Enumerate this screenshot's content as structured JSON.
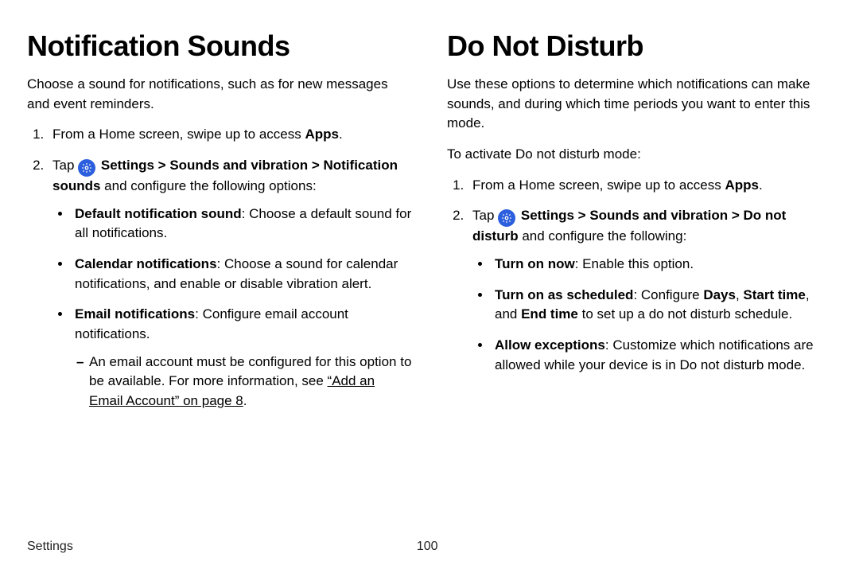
{
  "left": {
    "heading": "Notification Sounds",
    "intro": "Choose a sound for notifications, such as for new messages and event reminders.",
    "step1_a": "From a Home screen, swipe up to access ",
    "step1_b": "Apps",
    "step1_c": ".",
    "step2_a": "Tap ",
    "step2_settings": "Settings",
    "step2_chev1": " > ",
    "step2_sv": "Sounds and vibration",
    "step2_chev2": " > ",
    "step2_ns": "Notification sounds",
    "step2_tail": " and configure the following options:",
    "b1_label": "Default notification sound",
    "b1_text": ": Choose a default sound for all notifications.",
    "b2_label": "Calendar notifications",
    "b2_text": ": Choose a sound for calendar notifications, and enable or disable vibration alert.",
    "b3_label": "Email notifications",
    "b3_text": ": Configure email account notifications.",
    "b3_sub_a": "An email account must be configured for this option to be available. For more information, see ",
    "b3_sub_link": "“Add an Email Account” on page 8",
    "b3_sub_c": "."
  },
  "right": {
    "heading": "Do Not Disturb",
    "intro": "Use these options to determine which notifications can make sounds, and during which time periods you want to enter this mode.",
    "lead": "To activate Do not disturb mode:",
    "step1_a": "From a Home screen, swipe up to access ",
    "step1_b": "Apps",
    "step1_c": ".",
    "step2_a": "Tap ",
    "step2_settings": "Settings",
    "step2_chev1": " > ",
    "step2_sv": "Sounds and vibration",
    "step2_chev2": " > ",
    "step2_dnd": "Do not disturb",
    "step2_tail": " and configure the following:",
    "b1_label": "Turn on now",
    "b1_text": ": Enable this option.",
    "b2_label": "Turn on as scheduled",
    "b2_text_a": ": Configure ",
    "b2_days": "Days",
    "b2_text_b": ", ",
    "b2_start": "Start time",
    "b2_text_c": ", and ",
    "b2_end": "End time",
    "b2_text_d": " to set up a do not disturb schedule.",
    "b3_label": "Allow exceptions",
    "b3_text": ": Customize which notifications are allowed while your device is in Do not disturb mode."
  },
  "footer": {
    "section": "Settings",
    "page": "100"
  }
}
